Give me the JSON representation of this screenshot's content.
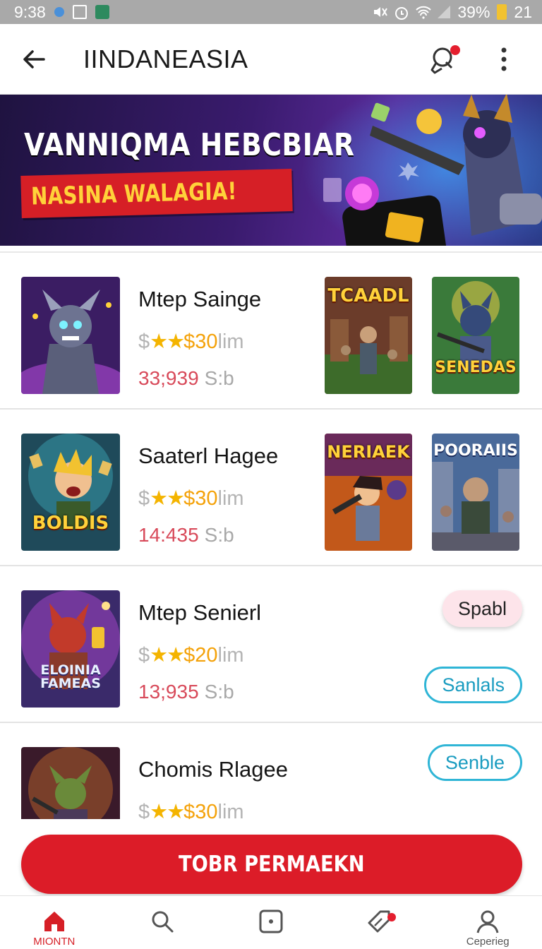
{
  "status_bar": {
    "time": "9:38",
    "battery": "39%",
    "extra": "21",
    "icons": [
      "location-icon",
      "qr-icon",
      "image-icon",
      "mute-icon",
      "alarm-icon",
      "wifi-icon",
      "signal-icon",
      "battery-icon"
    ]
  },
  "app_bar": {
    "title": "IINDANEASIA",
    "icons": [
      "back-arrow-icon",
      "ping-pong-icon",
      "more-vert-icon"
    ]
  },
  "banner": {
    "headline": "VANNIQMA HEBCBIAR",
    "cta": "NASINA WALAGIA!"
  },
  "games": [
    {
      "name": "Mtep Sainge",
      "price_prefix": "$",
      "stars": "★★",
      "price": "$30",
      "price_unit": "lim",
      "stat": "33;939",
      "stat_suffix": "S:b",
      "side_tiles": [
        "TCAADL",
        "SENEDAS"
      ]
    },
    {
      "name": "Saaterl Hagee",
      "price_prefix": "$",
      "stars": "★★",
      "price": "$30",
      "price_unit": "lim",
      "stat": "14:435",
      "stat_suffix": "S:b",
      "thumb_label": "BOLDIS",
      "side_tiles": [
        "NERIAEK",
        "POORAIIS"
      ]
    },
    {
      "name": "Mtep Senierl",
      "price_prefix": "$",
      "stars": "★★",
      "price": "$20",
      "price_unit": "lim",
      "stat": "13;935",
      "stat_suffix": "S:b",
      "thumb_label": "ELOINIA FAMEAS",
      "buttons": [
        "Spabl",
        "Sanlals"
      ]
    },
    {
      "name": "Chomis Rlagee",
      "price_prefix": "$",
      "stars": "★★",
      "price": "$30",
      "price_unit": "lim",
      "buttons": [
        "Senble"
      ]
    }
  ],
  "primary_button": "TOBR PERMAEKN",
  "bottom_nav": [
    {
      "label": "MIONTN",
      "icon": "home-icon",
      "active": true
    },
    {
      "label": "",
      "icon": "search-icon",
      "active": false
    },
    {
      "label": "",
      "icon": "dice-icon",
      "active": false
    },
    {
      "label": "",
      "icon": "sale-tag-icon",
      "active": false
    },
    {
      "label": "Ceperieg",
      "icon": "profile-icon",
      "active": false
    }
  ],
  "colors": {
    "accent_red": "#dc1c28",
    "star_gold": "#f4b400",
    "stat_red": "#d84a5a",
    "outline_blue": "#2fb5d6",
    "pink_chip": "#fde4ea"
  }
}
